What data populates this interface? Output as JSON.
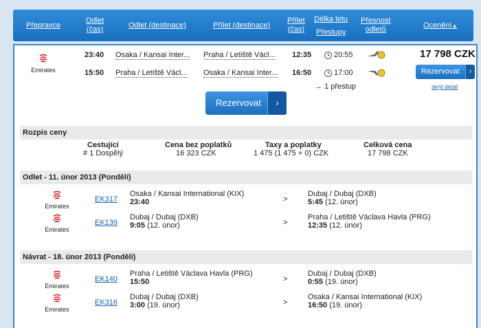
{
  "header": {
    "carrier": "Přepravce",
    "departure_time_1": "Odlet",
    "departure_time_2": "(čas)",
    "departure_dest": "Odlet (destinace)",
    "arrival_dest": "Přílet (destinace)",
    "arrival_time_1": "Přílet",
    "arrival_time_2": "(čas)",
    "duration": "Délka letu",
    "transfers": "Přestupy",
    "precision_1": "Přesnost",
    "precision_2": "odletů",
    "rating": "Ocenění"
  },
  "summary": {
    "airline": "Emirates",
    "outbound": {
      "dep_time": "23:40",
      "from": "Osaka / Kansai Inter...",
      "to": "Praha / Letiště Václ...",
      "arr_time": "12:35",
      "duration": "20:55"
    },
    "inbound": {
      "dep_time": "15:50",
      "from": "Praha / Letiště Václ...",
      "to": "Osaka / Kansai Inter...",
      "arr_time": "16:50",
      "duration": "17:00"
    },
    "transfers": "→ 1 přestup",
    "price": "17 798 CZK",
    "book_small": "Rezervovat",
    "hide_detail": "skrýt detail",
    "book_large": "Rezervovat",
    "arrow": "›"
  },
  "price_breakdown": {
    "title": "Rozpis ceny",
    "headers": [
      "Cestující",
      "Cena bez poplatků",
      "Taxy a poplatky",
      "Celková cena"
    ],
    "values": [
      "# 1 Dospělý",
      "16 323 CZK",
      "1 475 (1 475 + 0) CZK",
      "17 798 CZK"
    ]
  },
  "outbound_section": {
    "title": "Odlet - 11. únor 2013 (Pondělí)",
    "legs": [
      {
        "airline": "Emirates",
        "code": "EK317",
        "from": "Osaka / Kansai International (KIX)",
        "dep": "23:40",
        "dep_note": "",
        "sep": ">",
        "to": "Dubaj / Dubaj (DXB)",
        "arr": "5:45",
        "arr_note": "(12. únor)"
      },
      {
        "airline": "Emirates",
        "code": "EK139",
        "from": "Dubaj / Dubaj (DXB)",
        "dep": "9:05",
        "dep_note": "(12. únor)",
        "sep": ">",
        "to": "Praha / Letiště Václava Havla (PRG)",
        "arr": "12:35",
        "arr_note": "(12. únor)"
      }
    ]
  },
  "inbound_section": {
    "title": "Návrat - 18. únor 2013 (Pondělí)",
    "legs": [
      {
        "airline": "Emirates",
        "code": "EK140",
        "from": "Praha / Letiště Václava Havla (PRG)",
        "dep": "15:50",
        "dep_note": "",
        "sep": ">",
        "to": "Dubaj / Dubaj (DXB)",
        "arr": "0:55",
        "arr_note": "(19. únor)"
      },
      {
        "airline": "Emirates",
        "code": "EK316",
        "from": "Dubaj / Dubaj (DXB)",
        "dep": "3:00",
        "dep_note": "(19. únor)",
        "sep": ">",
        "to": "Osaka / Kansai International (KIX)",
        "arr": "16:50",
        "arr_note": "(19. únor)"
      }
    ]
  },
  "colors": {
    "header": "#1a6fc0",
    "panel_border": "#3c86cb",
    "link": "#1a5fa8",
    "background": "#d9e6f2"
  }
}
